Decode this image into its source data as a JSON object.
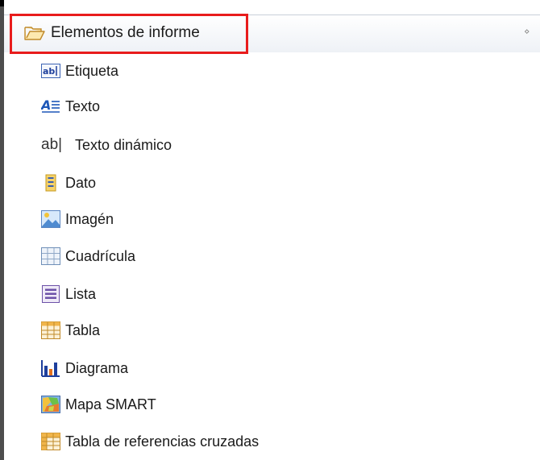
{
  "palette": {
    "drawer": {
      "title": "Elementos de informe",
      "icon": "folder-open-icon",
      "collapse_icon": "double-chevron-icon",
      "collapse_glyph": "‹›"
    },
    "items": [
      {
        "label": "Etiqueta",
        "icon": "label-icon"
      },
      {
        "label": "Texto",
        "icon": "text-icon"
      },
      {
        "label": "Texto dinámico",
        "icon": "dynamic-text-icon",
        "icon_text": "ab|"
      },
      {
        "label": "Dato",
        "icon": "data-icon"
      },
      {
        "label": "Imagén",
        "icon": "image-icon"
      },
      {
        "label": "Cuadrícula",
        "icon": "grid-icon"
      },
      {
        "label": "Lista",
        "icon": "list-icon"
      },
      {
        "label": "Tabla",
        "icon": "table-icon"
      },
      {
        "label": "Diagrama",
        "icon": "chart-icon"
      },
      {
        "label": "Mapa SMART",
        "icon": "map-icon"
      },
      {
        "label": "Tabla de referencias cruzadas",
        "icon": "crosstab-icon"
      }
    ],
    "highlight_color": "#e81c1c"
  }
}
